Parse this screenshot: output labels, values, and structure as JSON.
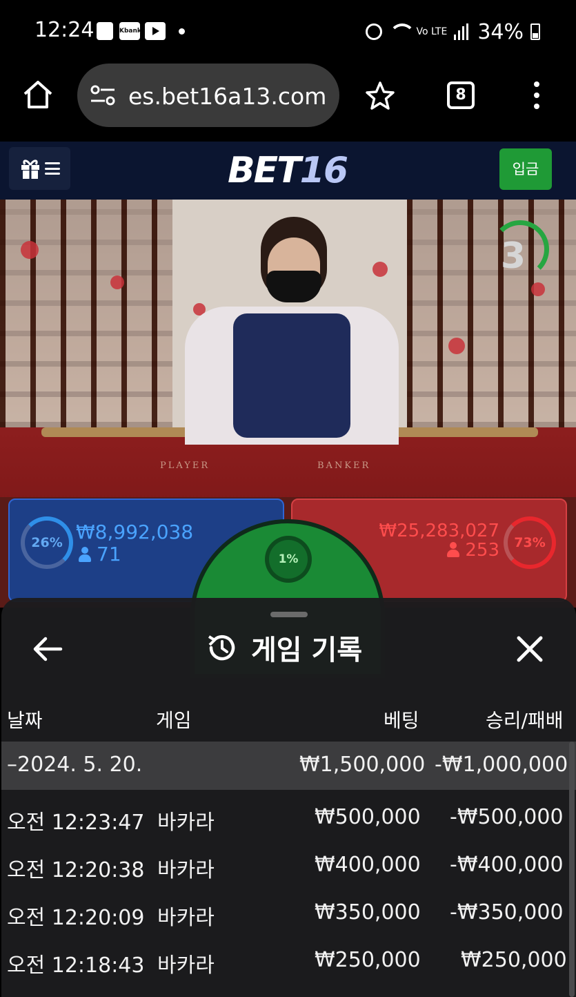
{
  "status_bar": {
    "time": "12:24",
    "kbank_label": "Kbank",
    "network_label": "Vo LTE",
    "battery": "34%"
  },
  "browser": {
    "url": "es.bet16a13.com",
    "tab_count": "8"
  },
  "site_header": {
    "logo_main": "BET",
    "logo_num": "16",
    "deposit_label": "입금"
  },
  "stream": {
    "countdown": "3",
    "table_label_player": "PLAYER",
    "table_label_banker": "BANKER"
  },
  "bets": {
    "player": {
      "percent": "26%",
      "amount": "₩8,992,038",
      "count": "71",
      "color": "#2f66d3"
    },
    "banker": {
      "percent": "73%",
      "amount": "₩25,283,027",
      "count": "253",
      "color": "#e8272d"
    },
    "tie": {
      "percent": "1%",
      "color": "#1a8a35"
    }
  },
  "history": {
    "title": "게임 기록",
    "columns": [
      "날짜",
      "게임",
      "베팅",
      "승리/패배"
    ],
    "date_group": {
      "date": "–2024. 5. 20.",
      "bet": "₩1,500,000",
      "result": "-₩1,000,000"
    },
    "rows": [
      {
        "time": "오전 12:23:47",
        "game": "바카라",
        "bet": "₩500,000",
        "result": "-₩500,000"
      },
      {
        "time": "오전 12:20:38",
        "game": "바카라",
        "bet": "₩400,000",
        "result": "-₩400,000"
      },
      {
        "time": "오전 12:20:09",
        "game": "바카라",
        "bet": "₩350,000",
        "result": "-₩350,000"
      },
      {
        "time": "오전 12:18:43",
        "game": "바카라",
        "bet": "₩250,000",
        "result": "₩250,000"
      }
    ]
  }
}
